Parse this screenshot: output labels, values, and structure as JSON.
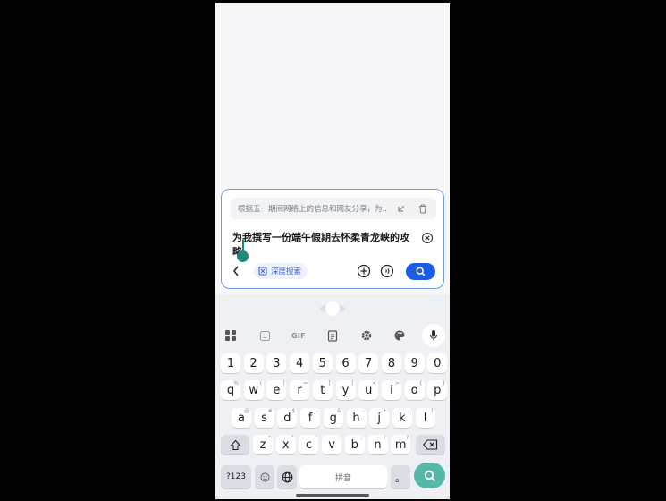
{
  "search": {
    "suggestion": "根据五一期间网络上的信息和网友分享，为...",
    "query": "为我撰写一份端午假期去怀柔青龙峡的攻略",
    "deep_search_label": "深度搜索"
  },
  "keyboard": {
    "toolbar_gif": "GIF",
    "number_row": [
      "1",
      "2",
      "3",
      "4",
      "5",
      "6",
      "7",
      "8",
      "9",
      "0"
    ],
    "row1": [
      {
        "k": "q",
        "s": "%"
      },
      {
        "k": "w",
        "s": "\\"
      },
      {
        "k": "e",
        "s": "|"
      },
      {
        "k": "r",
        "s": "="
      },
      {
        "k": "t",
        "s": "["
      },
      {
        "k": "y",
        "s": "]"
      },
      {
        "k": "u",
        "s": "<"
      },
      {
        "k": "i",
        "s": ">"
      },
      {
        "k": "o",
        "s": "{"
      },
      {
        "k": "p",
        "s": "}"
      }
    ],
    "row2": [
      {
        "k": "a",
        "s": "@"
      },
      {
        "k": "s",
        "s": "#"
      },
      {
        "k": "d",
        "s": "$"
      },
      {
        "k": "f",
        "s": "-"
      },
      {
        "k": "g",
        "s": "&"
      },
      {
        "k": "h",
        "s": "-"
      },
      {
        "k": "j",
        "s": "+"
      },
      {
        "k": "k",
        "s": "("
      },
      {
        "k": "l",
        "s": ")"
      }
    ],
    "row3": [
      {
        "k": "z",
        "s": "*"
      },
      {
        "k": "x",
        "s": "\""
      },
      {
        "k": "c",
        "s": "'"
      },
      {
        "k": "v",
        "s": ":"
      },
      {
        "k": "b",
        "s": ";"
      },
      {
        "k": "n",
        "s": "!"
      },
      {
        "k": "m",
        "s": "?"
      }
    ],
    "symbols_label": "?123",
    "space_label": "拼音",
    "period_label": "。"
  },
  "colors": {
    "accent": "#1a5ce6",
    "keyboard_accent": "#56b8a8"
  }
}
